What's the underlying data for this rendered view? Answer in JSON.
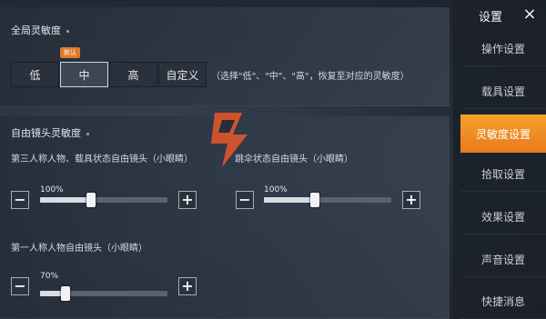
{
  "global": {
    "title": "全局灵敏度",
    "options": [
      "低",
      "中",
      "高",
      "自定义"
    ],
    "selected_badge": "默认",
    "hint": "（选择\"低\"、\"中\"、\"高\"，恢复至对应的灵敏度）"
  },
  "free_look": {
    "title": "自由镜头灵敏度",
    "sliders": [
      {
        "label": "第三人称人物、载具状态自由镜头（小眼睛）",
        "value_text": "100%",
        "fraction": 0.4
      },
      {
        "label": "跳伞状态自由镜头（小眼睛）",
        "value_text": "100%",
        "fraction": 0.4
      },
      {
        "label": "第一人称人物自由镜头（小眼睛）",
        "value_text": "70%",
        "fraction": 0.2
      }
    ],
    "minus": "−",
    "plus": "+"
  },
  "sidebar": {
    "title": "设置",
    "close": "×",
    "items": [
      "操作设置",
      "载具设置",
      "灵敏度设置",
      "拾取设置",
      "效果设置",
      "声音设置",
      "快捷消息"
    ],
    "active_index": 2
  },
  "watermark": {
    "text": "九游",
    "color": "#e8582a"
  }
}
